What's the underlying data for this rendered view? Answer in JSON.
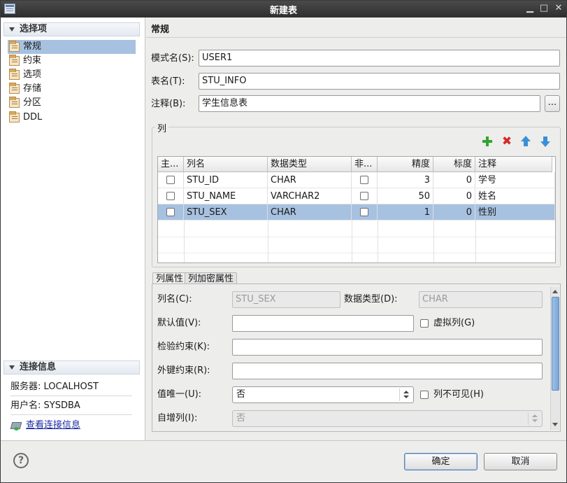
{
  "window": {
    "title": "新建表"
  },
  "left": {
    "options_header": "选择项",
    "nav_items": [
      "常规",
      "约束",
      "选项",
      "存储",
      "分区",
      "DDL"
    ],
    "connection_header": "连接信息",
    "server": "服务器: LOCALHOST",
    "user": "用户名: SYSDBA",
    "view_link": "查看连接信息"
  },
  "general": {
    "title": "常规",
    "schema_label": "模式名(S):",
    "schema_value": "USER1",
    "table_label": "表名(T):",
    "table_value": "STU_INFO",
    "comment_label": "注释(B):",
    "comment_value": "学生信息表",
    "ellipsis": "..."
  },
  "columns": {
    "group_label": "列",
    "headers": [
      "主...",
      "列名",
      "数据类型",
      "非...",
      "精度",
      "标度",
      "注释"
    ],
    "rows": [
      {
        "name": "STU_ID",
        "type": "CHAR",
        "precision": "3",
        "scale": "0",
        "comment": "学号"
      },
      {
        "name": "STU_NAME",
        "type": "VARCHAR2",
        "precision": "50",
        "scale": "0",
        "comment": "姓名"
      },
      {
        "name": "STU_SEX",
        "type": "CHAR",
        "precision": "1",
        "scale": "0",
        "comment": "性别"
      }
    ]
  },
  "tabs": [
    "列属性",
    "列加密属性"
  ],
  "props": {
    "colname_label": "列名(C):",
    "colname_value": "STU_SEX",
    "datatype_label": "数据类型(D):",
    "datatype_value": "CHAR",
    "default_label": "默认值(V):",
    "default_value": "",
    "virtual_label": "虚拟列(G)",
    "check_label": "检验约束(K):",
    "check_value": "",
    "fk_label": "外键约束(R):",
    "fk_value": "",
    "unique_label": "值唯一(U):",
    "unique_value": "否",
    "invisible_label": "列不可见(H)",
    "identity_label": "自增列(I):",
    "identity_value": "否"
  },
  "footer": {
    "help": "?",
    "ok": "确定",
    "cancel": "取消"
  }
}
